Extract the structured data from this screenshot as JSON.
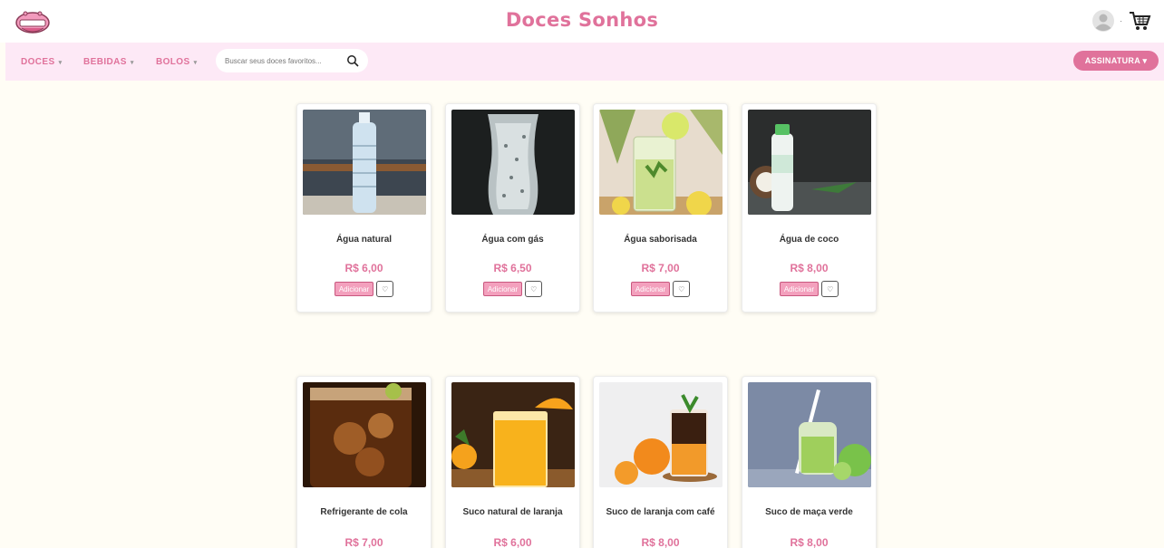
{
  "header": {
    "brand": "Doces Sonhos",
    "logo_icon": "cupcake-logo-icon",
    "avatar_icon": "user-avatar-icon",
    "cart_icon": "shopping-cart-icon",
    "menu_caret": "·"
  },
  "nav": {
    "items": [
      {
        "label": "DOCES"
      },
      {
        "label": "BEBIDAS"
      },
      {
        "label": "BOLOS"
      }
    ],
    "caret": "▾",
    "search_placeholder": "Buscar seus doces favoritos...",
    "search_icon": "search-icon",
    "subscription_label": "ASSINATURA ▾"
  },
  "products": [
    {
      "name": "Água natural",
      "price": "R$ 6,00",
      "add_label": "Adicionar",
      "fav_icon": "heart-icon"
    },
    {
      "name": "Água com gás",
      "price": "R$ 6,50",
      "add_label": "Adicionar",
      "fav_icon": "heart-icon"
    },
    {
      "name": "Água saborisada",
      "price": "R$ 7,00",
      "add_label": "Adicionar",
      "fav_icon": "heart-icon"
    },
    {
      "name": "Água de coco",
      "price": "R$ 8,00",
      "add_label": "Adicionar",
      "fav_icon": "heart-icon"
    },
    {
      "name": "Refrigerante de cola",
      "price": "R$ 7,00"
    },
    {
      "name": "Suco natural de laranja",
      "price": "R$ 6,00"
    },
    {
      "name": "Suco de laranja com café",
      "price": "R$ 8,00"
    },
    {
      "name": "Suco de maça verde",
      "price": "R$ 8,00"
    }
  ],
  "colors": {
    "brand_pink": "#e0729b",
    "nav_bg": "#fde9f6",
    "page_bg": "#fffdf5",
    "button_pink": "#f3a0bd"
  }
}
